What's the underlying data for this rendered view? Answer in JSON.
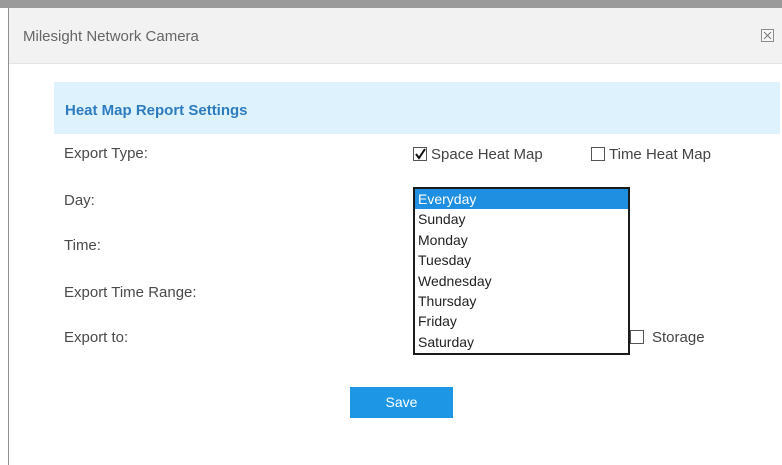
{
  "window": {
    "title": "Milesight Network Camera"
  },
  "section": {
    "title": "Heat Map Report Settings"
  },
  "form": {
    "export_type_label": "Export Type:",
    "day_label": "Day:",
    "time_label": "Time:",
    "export_time_range_label": "Export Time Range:",
    "export_to_label": "Export to:"
  },
  "export_type": {
    "space_heat_map": {
      "label": "Space Heat Map",
      "checked": true
    },
    "time_heat_map": {
      "label": "Time Heat Map",
      "checked": false
    }
  },
  "export_to": {
    "storage": {
      "label": "Storage",
      "checked": false
    }
  },
  "day_dropdown": {
    "selected": "Everyday",
    "options": [
      "Everyday",
      "Sunday",
      "Monday",
      "Tuesday",
      "Wednesday",
      "Thursday",
      "Friday",
      "Saturday"
    ]
  },
  "buttons": {
    "save_label": "Save"
  },
  "colors": {
    "section_header_bg": "#def2fd",
    "section_title": "#2e7cc0",
    "accent_button": "#1d96e6",
    "selected_option_bg": "#1e8fe1"
  }
}
